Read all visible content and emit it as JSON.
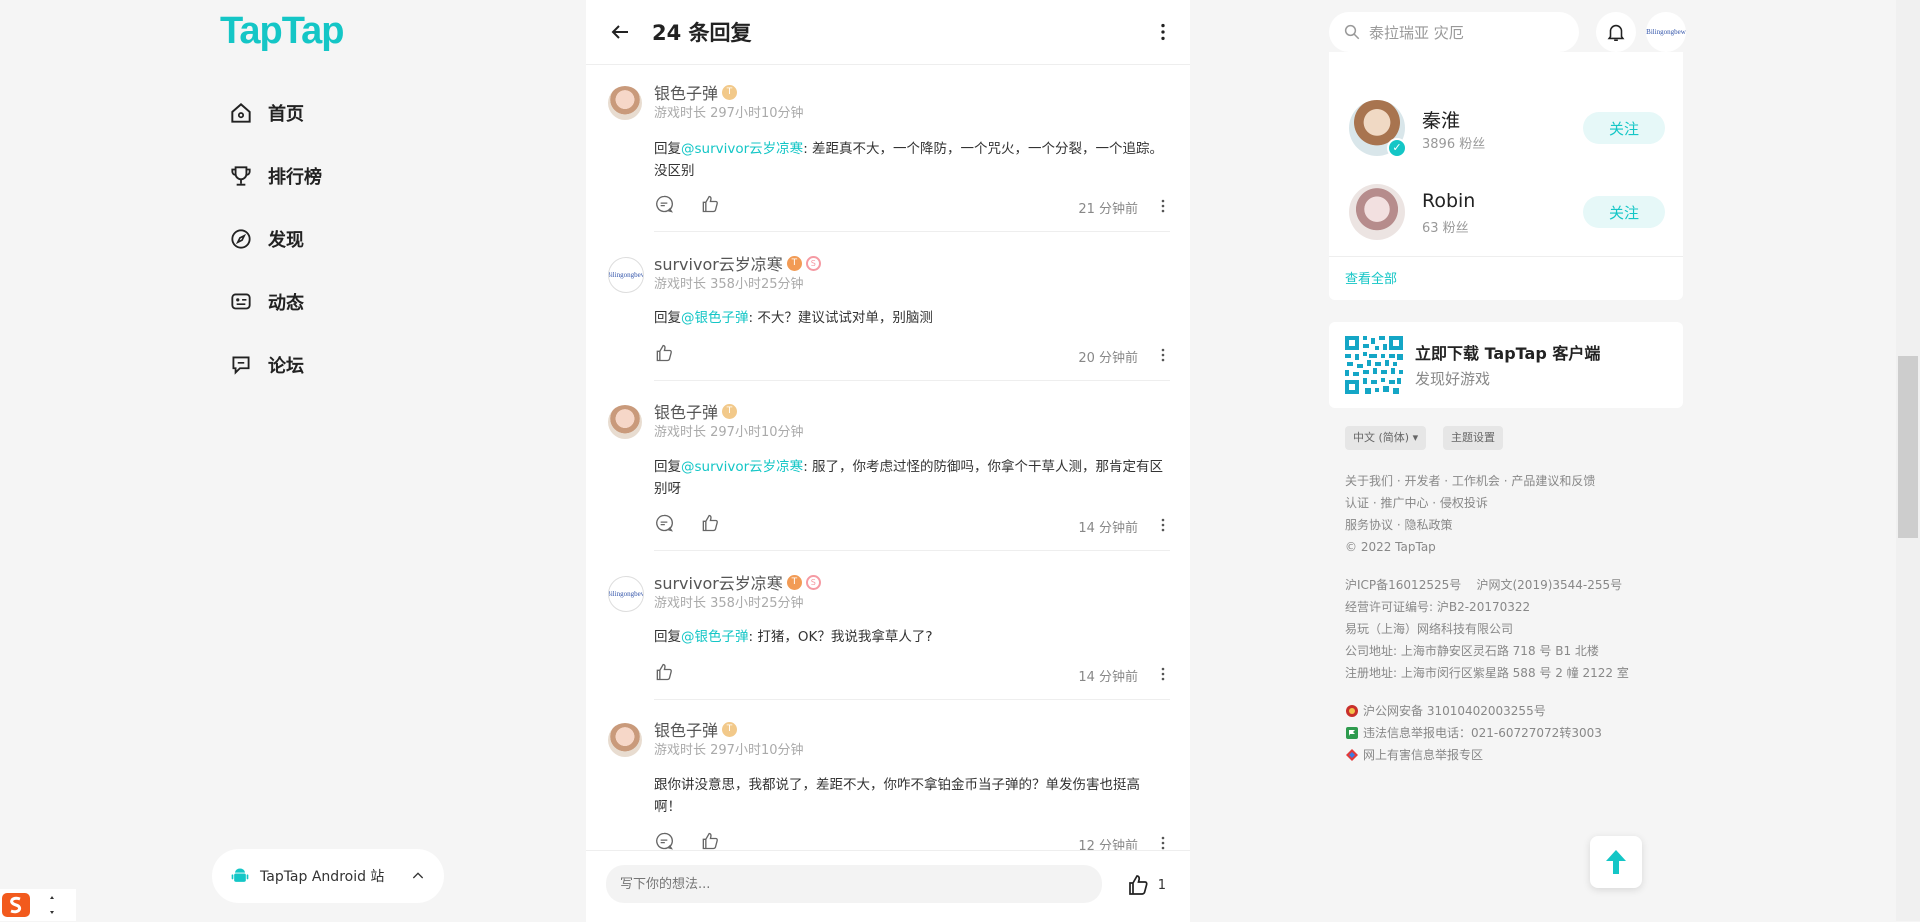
{
  "brand": {
    "logo": "TapTap",
    "accent": "#14c6c6"
  },
  "nav": {
    "items": [
      {
        "label": "首页",
        "icon": "home-icon"
      },
      {
        "label": "排行榜",
        "icon": "trophy-icon"
      },
      {
        "label": "发现",
        "icon": "discover-icon"
      },
      {
        "label": "动态",
        "icon": "feed-icon"
      },
      {
        "label": "论坛",
        "icon": "forum-icon"
      }
    ]
  },
  "android": {
    "label": "TapTap Android 站"
  },
  "header": {
    "title": "24 条回复"
  },
  "replies": [
    {
      "name": "银色子弹",
      "playtime": "游戏时长 297小时10分钟",
      "prefix": "回复",
      "mention": "@survivor云岁凉寒",
      "text": ": 差距真不大，一个降防，一个咒火，一个分裂，一个追踪。没区别",
      "time": "21 分钟前"
    },
    {
      "name": "survivor云岁凉寒",
      "playtime": "游戏时长 358小时25分钟",
      "prefix": "回复",
      "mention": "@银色子弹",
      "text": ": 不大？建议试试对单，别脑测",
      "time": "20 分钟前"
    },
    {
      "name": "银色子弹",
      "playtime": "游戏时长 297小时10分钟",
      "prefix": "回复",
      "mention": "@survivor云岁凉寒",
      "text": ": 服了，你考虑过怪的防御吗，你拿个干草人测，那肯定有区别呀",
      "time": "14 分钟前"
    },
    {
      "name": "survivor云岁凉寒",
      "playtime": "游戏时长 358小时25分钟",
      "prefix": "回复",
      "mention": "@银色子弹",
      "text": ": 打猪，OK？我说我拿草人了?",
      "time": "14 分钟前"
    },
    {
      "name": "银色子弹",
      "playtime": "游戏时长 297小时10分钟",
      "prefix": "",
      "mention": "",
      "text": "跟你讲没意思，我都说了，差距不大，你咋不拿铂金币当子弹的？单发伤害也挺高啊！",
      "time": "12 分钟前"
    }
  ],
  "composer": {
    "placeholder": "写下你的想法...",
    "like_count": "1"
  },
  "search": {
    "placeholder": "泰拉瑞亚 灾厄"
  },
  "follow": {
    "users": [
      {
        "name": "秦淮",
        "fans": "3896 粉丝",
        "button": "关注"
      },
      {
        "name": "Robin",
        "fans": "63 粉丝",
        "button": "关注"
      }
    ],
    "view_all": "查看全部"
  },
  "download": {
    "title": "立即下载 TapTap 客户端",
    "subtitle": "发现好游戏"
  },
  "footer": {
    "lang": "中文 (简体) ▾",
    "theme": "主题设置",
    "links1": "关于我们 · 开发者 · 工作机会 · 产品建议和反馈",
    "links2": "认证 · 推广中心 · 侵权投诉",
    "links3": "服务协议 · 隐私政策",
    "copyright": "© 2022 TapTap",
    "icp": "沪ICP备16012525号    沪网文(2019)3544-255号",
    "license": "经营许可证编号: 沪B2-20170322",
    "company": "易玩（上海）网络科技有限公司",
    "address1": "公司地址: 上海市静安区灵石路 718 号 B1 北楼",
    "address2": "注册地址: 上海市闵行区紫星路 588 号 2 幢 2122 室",
    "police": "沪公网安备 31010402003255号",
    "report_phone": "违法信息举报电话：021-60727072转3003",
    "report_zone": "网上有害信息举报专区"
  },
  "avatar_text": "Bilingongbew"
}
